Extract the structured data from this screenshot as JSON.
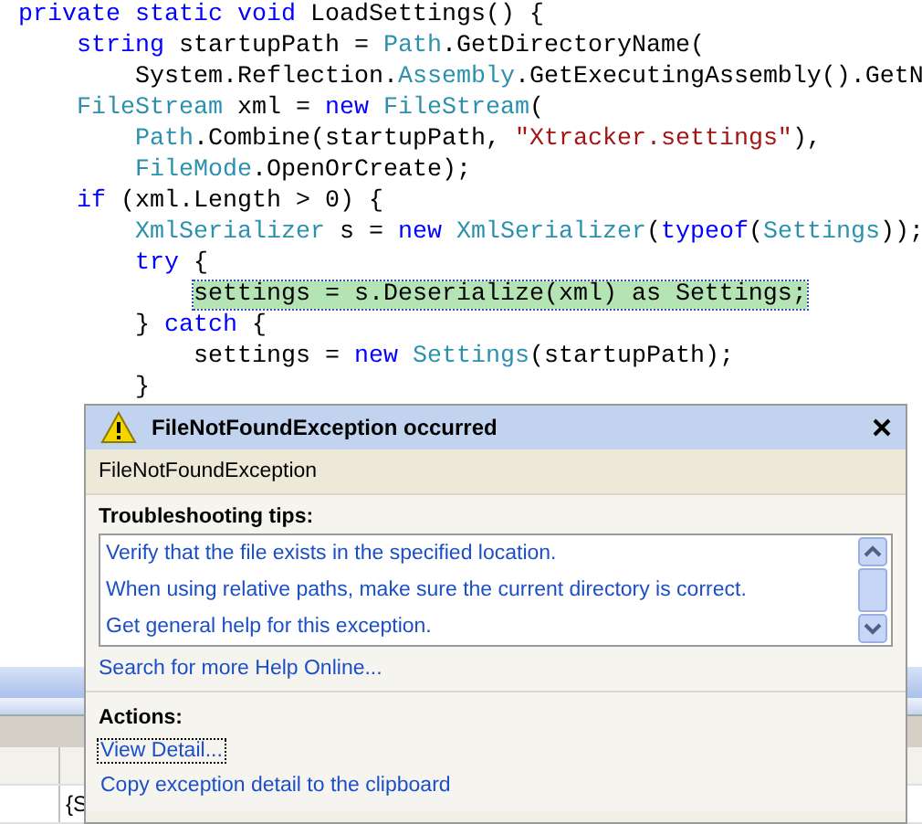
{
  "code_lines": [
    {
      "kind": "code",
      "tokens": [
        {
          "kind": "kw",
          "text": "private static void"
        },
        {
          "kind": "plain",
          "text": " LoadSettings() {"
        }
      ],
      "children": [
        {
          "kind": "code",
          "tokens": [
            {
              "kind": "kw",
              "text": "string"
            },
            {
              "kind": "plain",
              "text": " startupPath = "
            },
            {
              "kind": "type",
              "text": "Path"
            },
            {
              "kind": "plain",
              "text": ".GetDirectoryName("
            }
          ],
          "children": [
            {
              "kind": "code",
              "tokens": [
                {
                  "kind": "plain",
                  "text": "System.Reflection."
                },
                {
                  "kind": "type",
                  "text": "Assembly"
                },
                {
                  "kind": "plain",
                  "text": ".GetExecutingAssembly().GetN"
                }
              ]
            }
          ]
        },
        {
          "kind": "code",
          "tokens": [
            {
              "kind": "type",
              "text": "FileStream"
            },
            {
              "kind": "plain",
              "text": " xml = "
            },
            {
              "kind": "kw",
              "text": "new"
            },
            {
              "kind": "type",
              "text": " FileStream"
            },
            {
              "kind": "plain",
              "text": "("
            }
          ],
          "children": [
            {
              "kind": "code",
              "tokens": [
                {
                  "kind": "type",
                  "text": "Path"
                },
                {
                  "kind": "plain",
                  "text": ".Combine(startupPath, "
                },
                {
                  "kind": "str",
                  "text": "\"Xtracker.settings\""
                },
                {
                  "kind": "plain",
                  "text": "),"
                }
              ]
            },
            {
              "kind": "code",
              "tokens": [
                {
                  "kind": "type",
                  "text": "FileMode"
                },
                {
                  "kind": "plain",
                  "text": ".OpenOrCreate);"
                }
              ]
            }
          ]
        },
        {
          "kind": "code",
          "tokens": [
            {
              "kind": "kw",
              "text": "if"
            },
            {
              "kind": "plain",
              "text": " (xml.Length > 0) {"
            }
          ],
          "children": [
            {
              "kind": "code",
              "tokens": [
                {
                  "kind": "type",
                  "text": "XmlSerializer"
                },
                {
                  "kind": "plain",
                  "text": " s = "
                },
                {
                  "kind": "kw",
                  "text": "new"
                },
                {
                  "kind": "type",
                  "text": " XmlSerializer"
                },
                {
                  "kind": "plain",
                  "text": "("
                },
                {
                  "kind": "kw",
                  "text": "typeof"
                },
                {
                  "kind": "plain",
                  "text": "("
                },
                {
                  "kind": "type",
                  "text": "Settings"
                },
                {
                  "kind": "plain",
                  "text": "));"
                }
              ]
            },
            {
              "kind": "code",
              "tokens": [
                {
                  "kind": "kw",
                  "text": "try"
                },
                {
                  "kind": "plain",
                  "text": " {"
                }
              ],
              "children": [
                {
                  "kind": "code",
                  "tokens": [
                    {
                      "kind": "current",
                      "text": "settings = s.Deserialize(xml) as Settings;"
                    }
                  ]
                }
              ]
            },
            {
              "kind": "code",
              "tokens": [
                {
                  "kind": "plain",
                  "text": "} "
                },
                {
                  "kind": "kw",
                  "text": "catch"
                },
                {
                  "kind": "plain",
                  "text": " {"
                }
              ],
              "children": [
                {
                  "kind": "code",
                  "tokens": [
                    {
                      "kind": "plain",
                      "text": "settings = "
                    },
                    {
                      "kind": "kw",
                      "text": "new"
                    },
                    {
                      "kind": "type",
                      "text": " Settings"
                    },
                    {
                      "kind": "plain",
                      "text": "(startupPath);"
                    }
                  ]
                }
              ]
            },
            {
              "kind": "code",
              "tokens": [
                {
                  "kind": "plain",
                  "text": "}"
                }
              ]
            }
          ]
        },
        {
          "kind": "blank"
        },
        {
          "kind": "blank"
        },
        {
          "kind": "blank"
        },
        {
          "kind": "blank"
        },
        {
          "kind": "blank"
        },
        {
          "kind": "blank"
        },
        {
          "kind": "blank"
        },
        {
          "kind": "blank"
        }
      ]
    }
  ],
  "bottom_panel": {
    "row_cell": "{S"
  },
  "exception_popup": {
    "title": "FileNotFoundException occurred",
    "exception_type": "FileNotFoundException",
    "tips_heading": "Troubleshooting tips:",
    "tips": [
      "Verify that the file exists in the specified location.",
      "When using relative paths, make sure the current directory is correct.",
      "Get general help for this exception."
    ],
    "search_link": "Search for more Help Online...",
    "actions_heading": "Actions:",
    "actions": [
      {
        "label": "View Detail...",
        "selected": true
      },
      {
        "label": "Copy exception detail to the clipboard",
        "selected": false
      }
    ]
  }
}
